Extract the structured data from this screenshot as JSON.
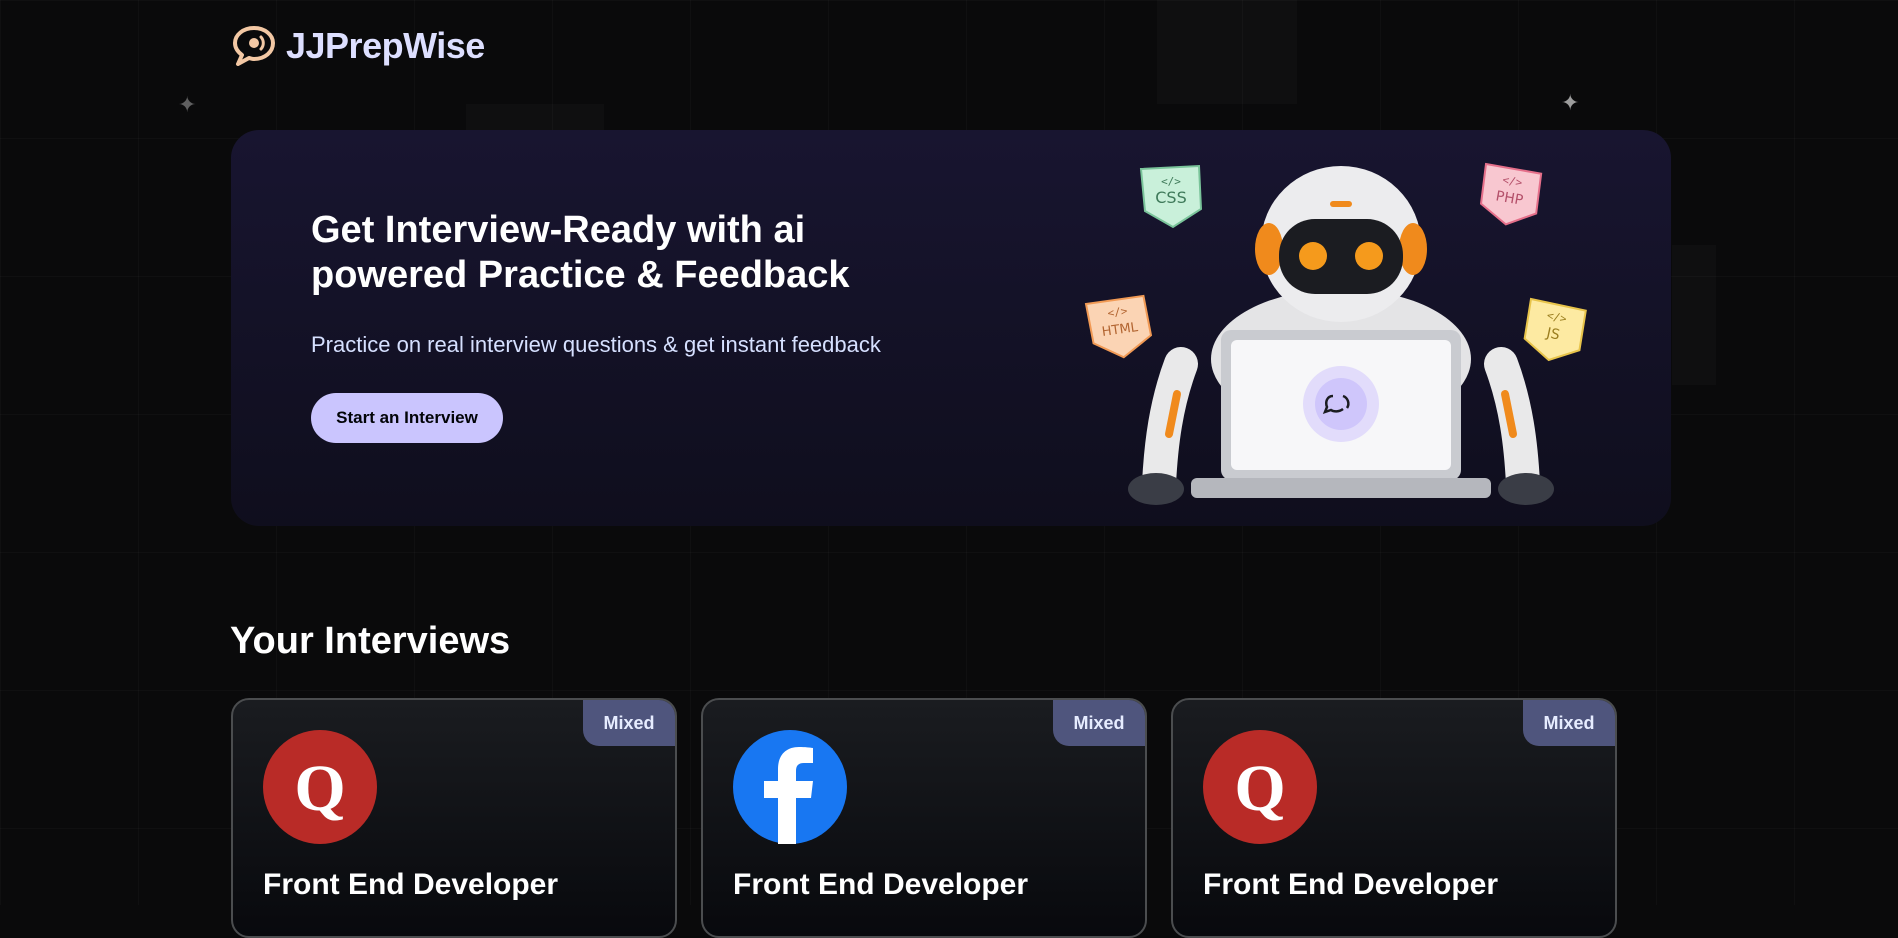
{
  "brand": {
    "name": "JJPrepWise",
    "icon": "chat-bubble-logo"
  },
  "hero": {
    "title": "Get Interview-Ready with ai powered Practice & Feedback",
    "subtitle": "Practice on real interview questions & get instant feedback",
    "cta_label": "Start an Interview",
    "illustration": "robot-with-laptop",
    "tags": [
      "CSS",
      "PHP",
      "HTML",
      "JS"
    ]
  },
  "interviews": {
    "heading": "Your Interviews",
    "cards": [
      {
        "role": "Front End Developer",
        "type": "Mixed",
        "company_icon": "quora-icon"
      },
      {
        "role": "Front End Developer",
        "type": "Mixed",
        "company_icon": "facebook-icon"
      },
      {
        "role": "Front End Developer",
        "type": "Mixed",
        "company_icon": "quora-icon"
      }
    ]
  },
  "colors": {
    "background": "#0a0a0b",
    "brand_text": "#dddfff",
    "primary_button": "#cac5fe",
    "badge": "#4f557d",
    "quora_red": "#b92b27",
    "facebook_blue": "#1877f2"
  }
}
